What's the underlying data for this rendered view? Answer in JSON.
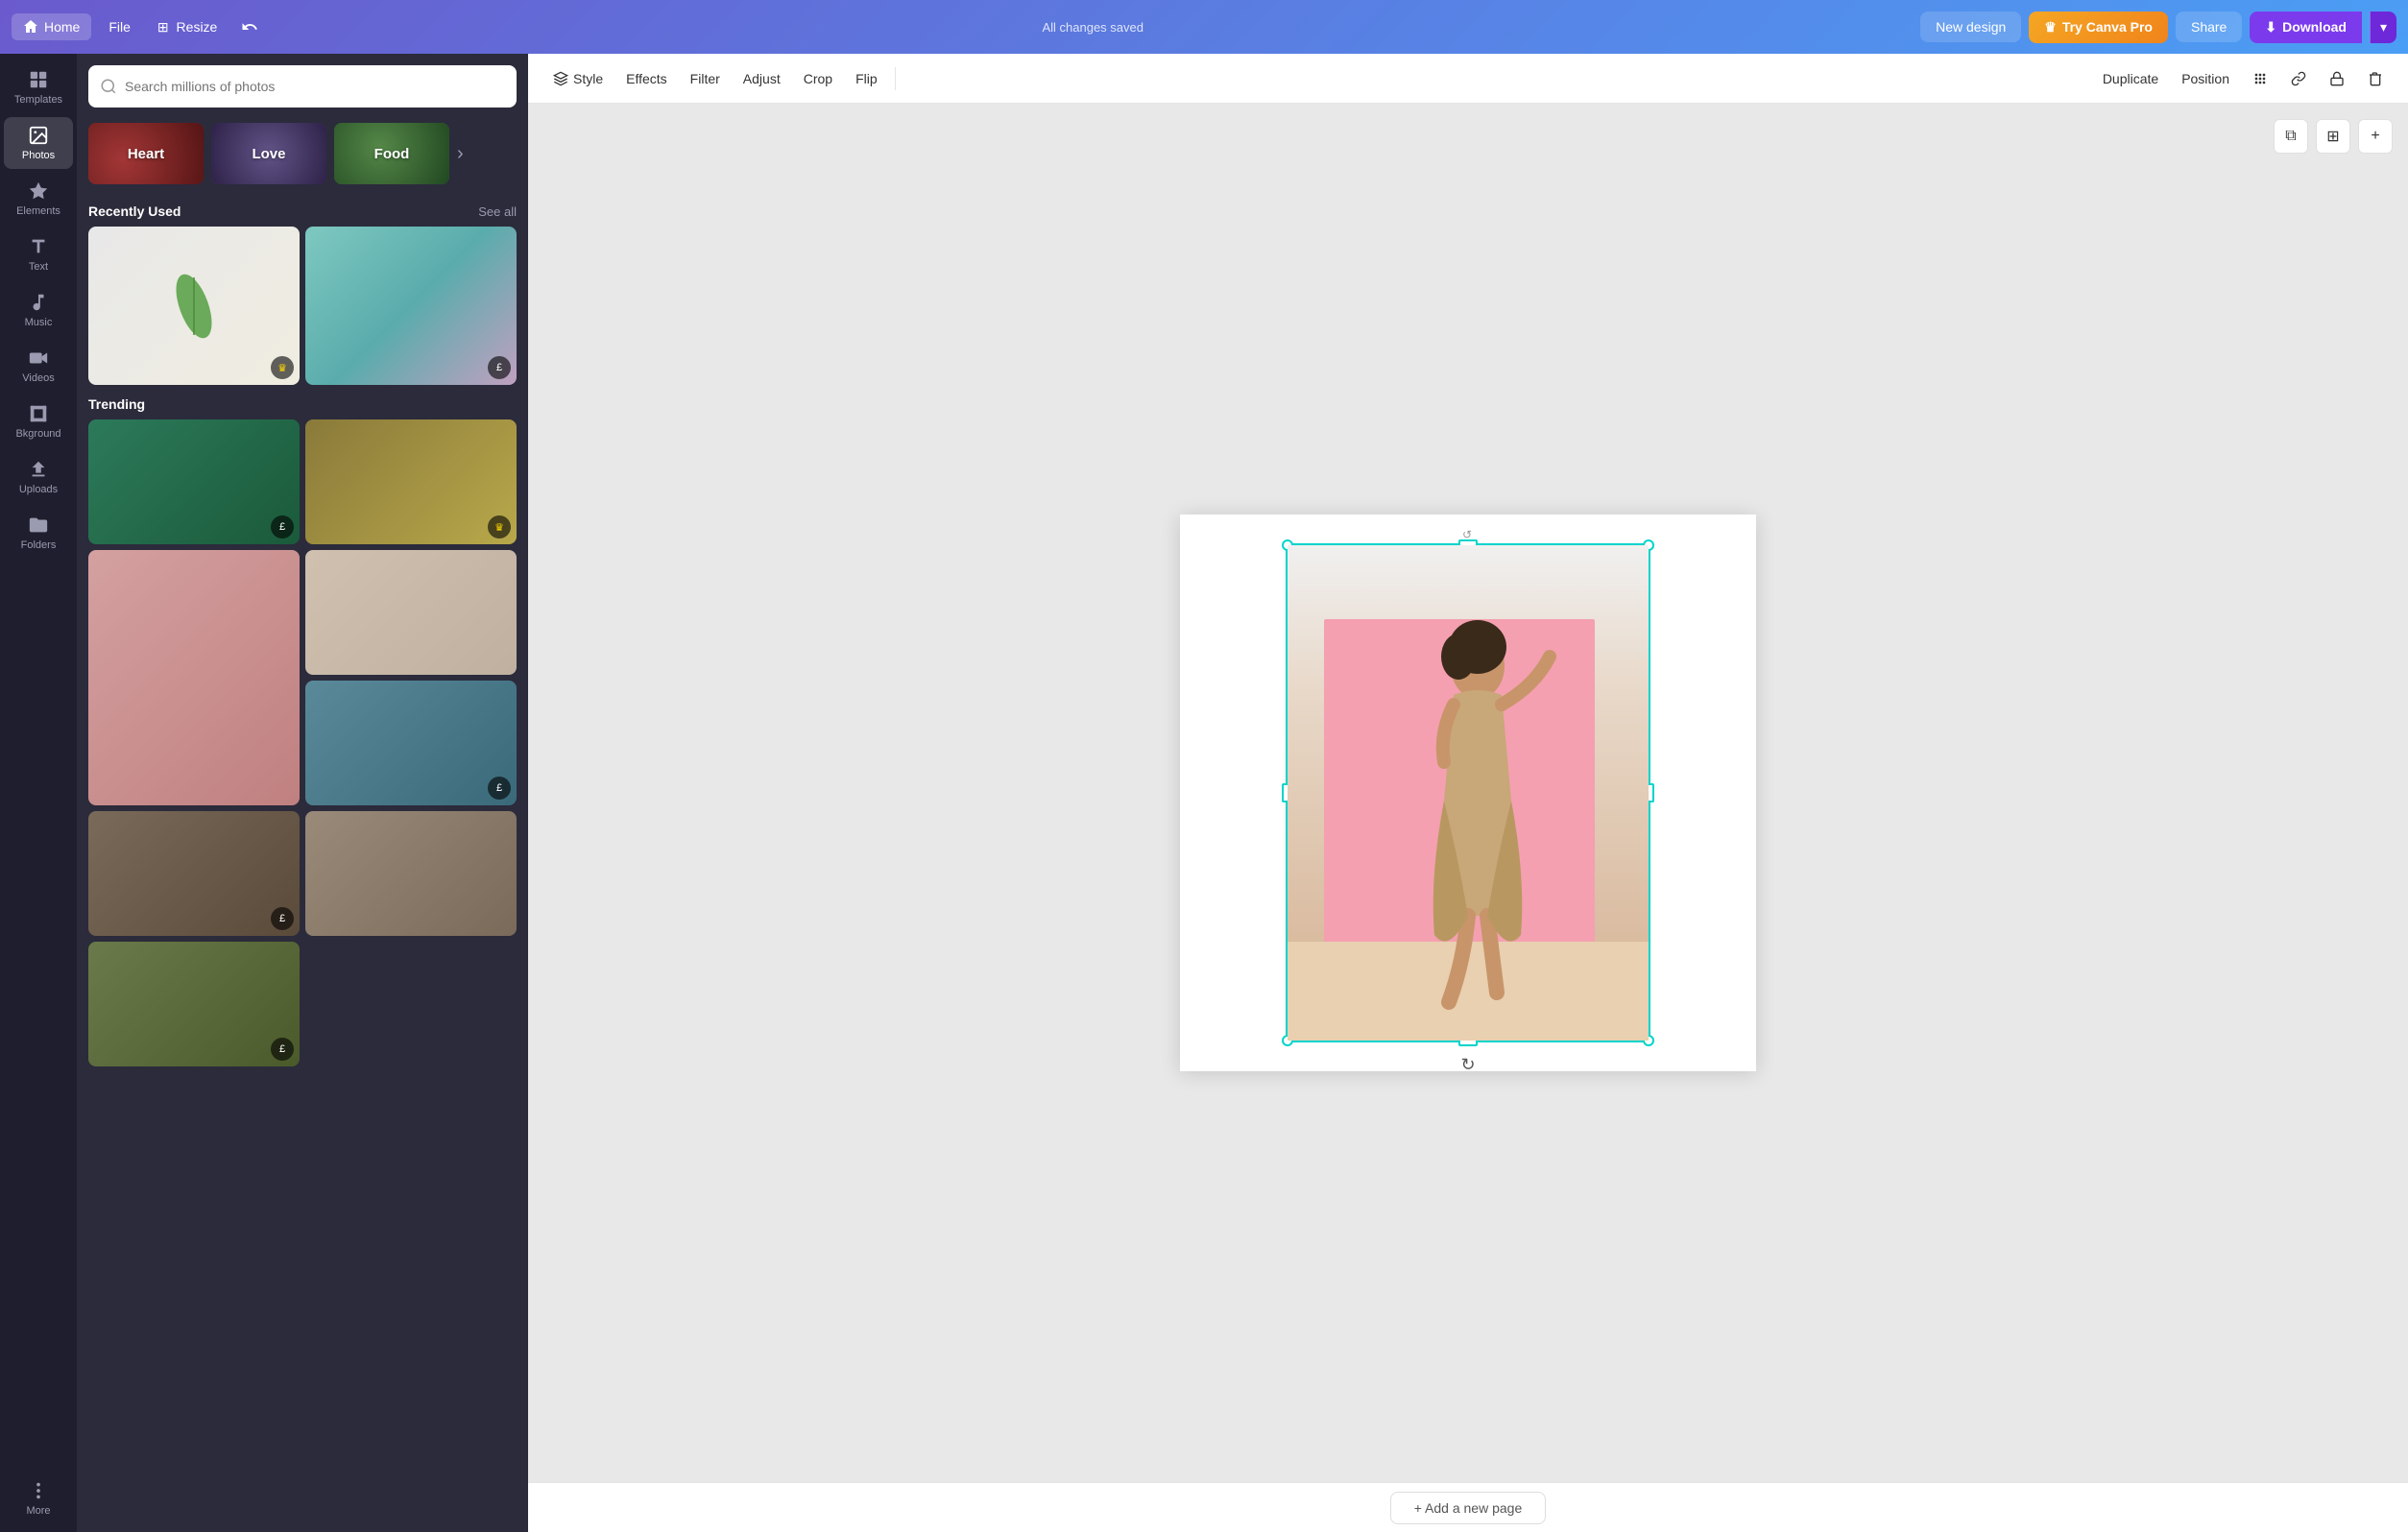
{
  "topNav": {
    "homeLabel": "Home",
    "fileLabel": "File",
    "resizeLabel": "Resize",
    "savedStatus": "All changes saved",
    "newDesignLabel": "New design",
    "tryProLabel": "Try Canva Pro",
    "shareLabel": "Share",
    "downloadLabel": "Download"
  },
  "sidebar": {
    "items": [
      {
        "id": "templates",
        "label": "Templates",
        "icon": "grid-icon"
      },
      {
        "id": "photos",
        "label": "Photos",
        "icon": "photo-icon",
        "active": true
      },
      {
        "id": "elements",
        "label": "Elements",
        "icon": "elements-icon"
      },
      {
        "id": "text",
        "label": "Text",
        "icon": "text-icon"
      },
      {
        "id": "music",
        "label": "Music",
        "icon": "music-icon"
      },
      {
        "id": "videos",
        "label": "Videos",
        "icon": "video-icon"
      },
      {
        "id": "bkground",
        "label": "Bkground",
        "icon": "background-icon"
      },
      {
        "id": "uploads",
        "label": "Uploads",
        "icon": "upload-icon"
      },
      {
        "id": "folders",
        "label": "Folders",
        "icon": "folder-icon"
      },
      {
        "id": "more",
        "label": "More",
        "icon": "more-icon"
      }
    ]
  },
  "photosPanel": {
    "searchPlaceholder": "Search millions of photos",
    "categories": [
      {
        "id": "heart",
        "label": "Heart"
      },
      {
        "id": "love",
        "label": "Love"
      },
      {
        "id": "food",
        "label": "Food"
      }
    ],
    "recentlyUsed": {
      "title": "Recently Used",
      "seeAllLabel": "See all"
    },
    "trending": {
      "title": "Trending"
    }
  },
  "toolbar": {
    "styleLabel": "Style",
    "effectsLabel": "Effects",
    "filterLabel": "Filter",
    "adjustLabel": "Adjust",
    "cropLabel": "Crop",
    "flipLabel": "Flip",
    "duplicateLabel": "Duplicate",
    "positionLabel": "Position"
  },
  "canvas": {
    "addPageLabel": "+ Add a new page"
  }
}
